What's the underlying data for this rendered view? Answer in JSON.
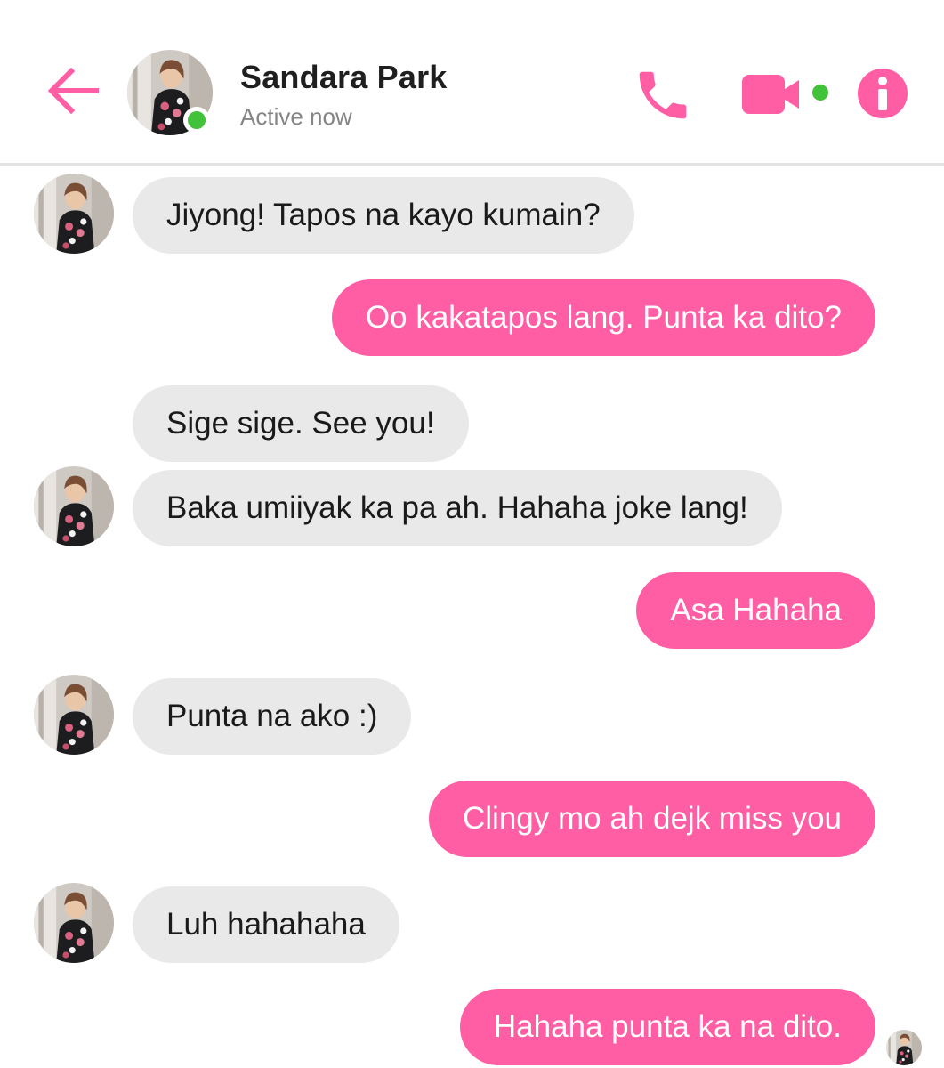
{
  "colors": {
    "accent": "#ff5ea4",
    "incoming_bubble": "#e9e9e9",
    "online": "#42c13a",
    "status_text": "#858585"
  },
  "header": {
    "back_icon": "arrow-left-icon",
    "contact_name": "Sandara Park",
    "status": "Active now",
    "call_icon": "phone-icon",
    "video_icon": "video-camera-icon",
    "info_icon": "info-icon"
  },
  "messages": [
    {
      "sender": "them",
      "text": "Jiyong! Tapos na kayo kumain?"
    },
    {
      "sender": "me",
      "text": "Oo kakatapos lang. Punta ka dito?"
    },
    {
      "sender": "them",
      "text": "Sige sige. See you!"
    },
    {
      "sender": "them",
      "text": "Baka umiiyak ka pa ah. Hahaha joke lang!"
    },
    {
      "sender": "me",
      "text": "Asa Hahaha"
    },
    {
      "sender": "them",
      "text": "Punta na ako :)"
    },
    {
      "sender": "me",
      "text": "Clingy mo ah dejk miss you"
    },
    {
      "sender": "them",
      "text": "Luh hahahaha"
    },
    {
      "sender": "me",
      "text": "Hahaha punta ka na dito."
    }
  ]
}
